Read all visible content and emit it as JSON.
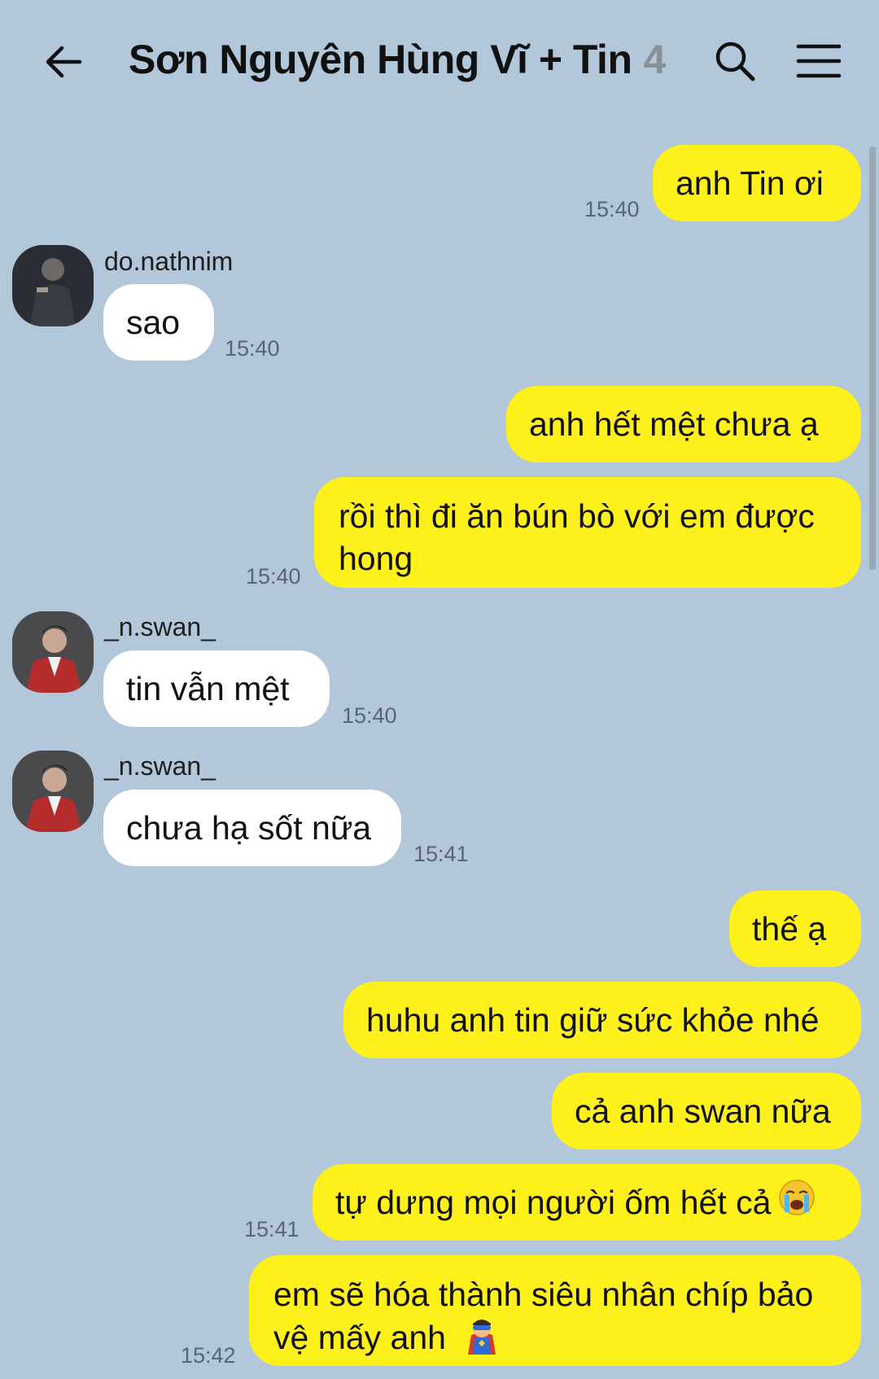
{
  "header": {
    "title": "Sơn Nguyên Hùng Vĩ + Tin",
    "member_count": "4"
  },
  "messages": [
    {
      "type": "out",
      "text": "anh Tin ơi",
      "time": "15:40"
    },
    {
      "type": "in",
      "sender": "do.nathnim",
      "text": "sao",
      "time": "15:40"
    },
    {
      "type": "out",
      "text": "anh hết mệt chưa ạ"
    },
    {
      "type": "out",
      "text": "rồi thì đi ăn bún bò với em được hong",
      "time": "15:40"
    },
    {
      "type": "in",
      "sender": "_n.swan_",
      "text": "tin vẫn mệt",
      "time": "15:40"
    },
    {
      "type": "in",
      "sender": "_n.swan_",
      "text": "chưa hạ sốt nữa",
      "time": "15:41"
    },
    {
      "type": "out",
      "text": "thế ạ"
    },
    {
      "type": "out",
      "text": "huhu anh tin giữ sức khỏe nhé"
    },
    {
      "type": "out",
      "text": "cả anh swan nữa"
    },
    {
      "type": "out",
      "text": "tự dưng mọi người ốm hết cả",
      "time": "15:41",
      "emoji": "crying-face"
    },
    {
      "type": "out",
      "text": "em sẽ hóa thành siêu nhân chíp bảo vệ mấy anh",
      "time": "15:42",
      "emoji": "superhero"
    }
  ],
  "colors": {
    "background": "#b2c7d9",
    "outgoing_bubble": "#fef01b",
    "incoming_bubble": "#ffffff"
  }
}
